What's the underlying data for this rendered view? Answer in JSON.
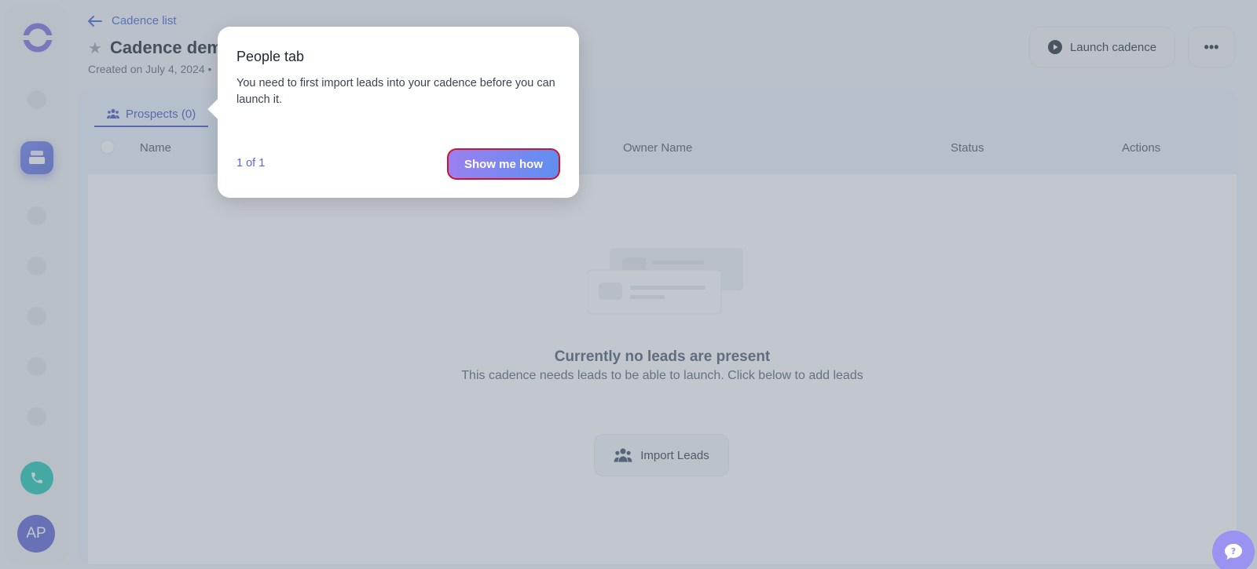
{
  "header": {
    "back_label": "Cadence list",
    "title": "Cadence dem",
    "created": "Created on July 4, 2024 •",
    "launch_label": "Launch cadence",
    "more_label": "•••"
  },
  "sidebar": {
    "avatar_initials": "AP"
  },
  "tabs": [
    {
      "label": "Prospects (0)"
    }
  ],
  "table": {
    "columns": [
      "Name",
      "Owner Name",
      "Status",
      "Actions"
    ]
  },
  "empty_state": {
    "title": "Currently no leads are present",
    "subtitle": "This cadence needs leads to be able to launch. Click below to add leads",
    "import_label": "Import Leads"
  },
  "tooltip": {
    "title": "People tab",
    "body": "You need to first import leads into your cadence before you can launch it.",
    "step": "1 of 1",
    "cta": "Show me how"
  },
  "colors": {
    "accent": "#4154c4",
    "brand_purple": "#7b6fe0",
    "teal": "#1cc8b2",
    "highlight_border": "#d0122a"
  }
}
